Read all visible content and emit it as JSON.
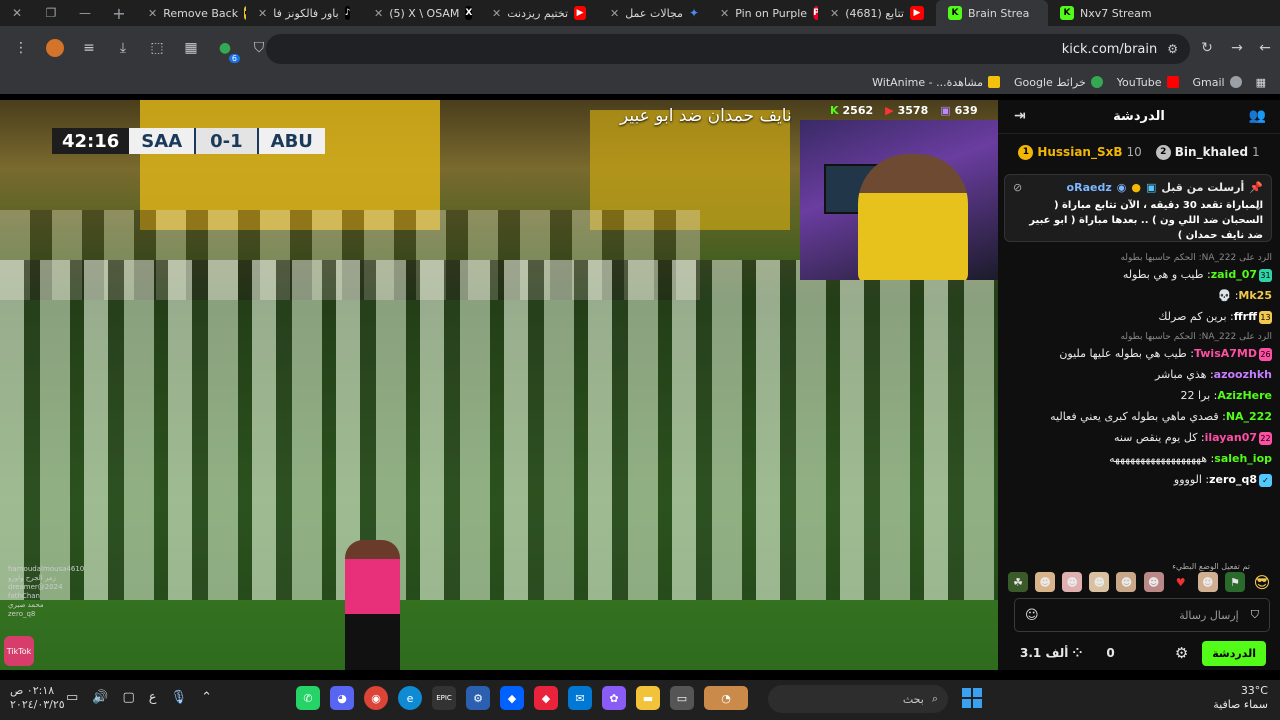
{
  "browser": {
    "tabs": [
      {
        "title": "Remove Back",
        "favicon": "remove-bg-icon",
        "color": "#e6c22a"
      },
      {
        "title": "باور فالكونز فا",
        "favicon": "tiktok-icon",
        "color": "#000000"
      },
      {
        "title": "(5) X \\ OSAM",
        "favicon": "x-icon",
        "color": "#000000"
      },
      {
        "title": "تختيم ريزدنت",
        "favicon": "youtube-icon",
        "color": "#ff0000"
      },
      {
        "title": "مجالات عمل",
        "favicon": "gemini-icon",
        "color": "#4a8af4"
      },
      {
        "title": "Pin on Purple",
        "favicon": "pinterest-icon",
        "color": "#e60023"
      },
      {
        "title": "(4681) تتابع",
        "favicon": "youtube-icon",
        "color": "#ff0000"
      },
      {
        "title": "Brain Strea",
        "favicon": "kick-icon",
        "color": "#53fc18"
      },
      {
        "title": "Nxv7 Stream",
        "favicon": "kick-icon",
        "color": "#53fc18"
      }
    ],
    "active_tab_index": 7,
    "url": "kick.com/brain",
    "bookmarks": [
      {
        "label": "Gmail",
        "icon": "gmail-icon",
        "color": "#ea4335"
      },
      {
        "label": "YouTube",
        "icon": "youtube-icon",
        "color": "#ff0000"
      },
      {
        "label": "Google خرائط",
        "icon": "maps-icon",
        "color": "#34a853"
      },
      {
        "label": "WitAnime - ...مشاهدة",
        "icon": "witanime-icon",
        "color": "#f4c20d"
      }
    ]
  },
  "stream": {
    "title": "نايف حمدان ضد ابو عبير",
    "scoreboard": {
      "clock": "42:16",
      "home": "SAA",
      "score": "0-1",
      "away": "ABU"
    },
    "stats": {
      "viewers_a": "639",
      "viewers_b": "3578",
      "viewers_c": "2562"
    },
    "mini_chat": [
      "hamoudalmousa4610",
      "زمر الجرح واوزو",
      "dreamer@2024",
      "fathChan",
      "محمد صبري",
      "zero_q8"
    ],
    "corner_logo": "TikTok"
  },
  "chat": {
    "header_title": "الدردشة",
    "leaderboard": [
      {
        "rank": "2",
        "name": "Bin_khaled",
        "value": "1",
        "color": "#c0c0c0"
      },
      {
        "rank": "1",
        "name": "Hussian_SxB",
        "value": "10",
        "color": "#f2b705"
      }
    ],
    "pinned": {
      "label": "أرسلت من قبل",
      "user": "oRaedz",
      "message": "المباراة تقعد 30 دقيقه ، الآن تتابع مباراة ( السحبان ضد اللي ون ) .. بعدها مباراة ( ابو عبير ضد نايف حمدان )"
    },
    "messages": [
      {
        "reply": "الرد على NA_222: الحكم حاسبها بطوله",
        "user": "zaid_07",
        "user_color": "#53fc18",
        "text": "طيب و هي بطوله"
      },
      {
        "reply": "",
        "user": "Mk25",
        "user_color": "#f2c94c",
        "text": "💀"
      },
      {
        "reply": "",
        "user": "ffrff",
        "user_color": "#ffffff",
        "text": "برين كم صرلك"
      },
      {
        "reply": "الرد على NA_222: الحكم حاسبها بطوله",
        "user": "TwisA7MD",
        "user_color": "#ff4fa3",
        "text": "طيب هي بطوله عليها مليون"
      },
      {
        "reply": "",
        "user": "azoozhkh",
        "user_color": "#c77dff",
        "text": "هذي مباشر"
      },
      {
        "reply": "",
        "user": "AzizHere",
        "user_color": "#53fc18",
        "text": "برا 22"
      },
      {
        "reply": "",
        "user": "NA_222",
        "user_color": "#53fc18",
        "text": "قصدي ماهي بطوله كبرى يعني فعاليه"
      },
      {
        "reply": "",
        "user": "ilayan07",
        "user_color": "#ff4fa3",
        "text": "كل يوم ينقص سنه"
      },
      {
        "reply": "",
        "user": "saleh_iop",
        "user_color": "#53fc18",
        "text": "ههههههههههههههههههه"
      },
      {
        "reply": "",
        "user": "zero_q8",
        "user_color": "#ffffff",
        "text": "الوووو"
      }
    ],
    "emote_label": "تم تفعيل الوضع البطيء",
    "input_placeholder": "إرسال رسالة",
    "footer": {
      "count": "0",
      "followers": "3.1 ألف",
      "send_label": "الدردشة"
    }
  },
  "taskbar": {
    "weather_temp": "33°C",
    "weather_desc": "سماء صافية",
    "search_placeholder": "بحث",
    "time": "٠٢:١٨ ص",
    "date": "٢٠٢٤/٠٣/٢٥",
    "lang": "ع"
  }
}
